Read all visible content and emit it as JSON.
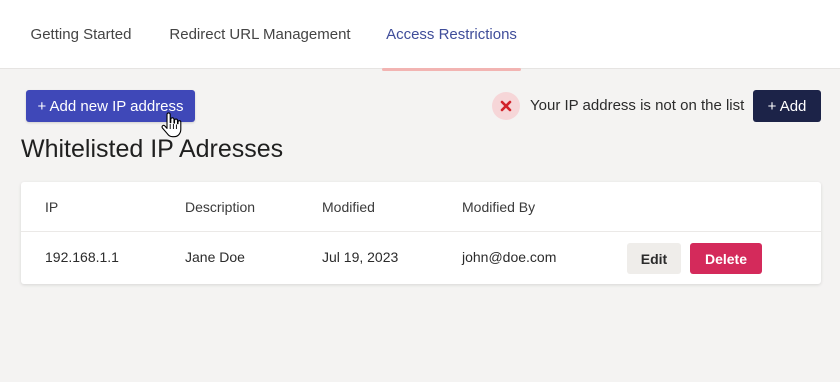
{
  "tabs": [
    {
      "label": "Getting Started",
      "active": false
    },
    {
      "label": "Redirect URL Management",
      "active": false
    },
    {
      "label": "Access Restrictions",
      "active": true
    }
  ],
  "toolbar": {
    "add_ip_label": "+ Add new IP address",
    "status_icon": "x-mark-icon",
    "status_text": "Your IP address is not on the list",
    "add_label": "+ Add"
  },
  "page": {
    "title": "Whitelisted IP Adresses"
  },
  "table": {
    "headers": [
      "IP",
      "Description",
      "Modified",
      "Modified By"
    ],
    "rows": [
      {
        "ip": "192.168.1.1",
        "description": "Jane Doe",
        "modified": "Jul 19, 2023",
        "modified_by": "john@doe.com",
        "edit_label": "Edit",
        "delete_label": "Delete"
      }
    ]
  },
  "colors": {
    "primary": "#3f48b8",
    "dark": "#1c2348",
    "danger": "#d42a5b",
    "active_tab_underline": "#f2b4b2"
  }
}
